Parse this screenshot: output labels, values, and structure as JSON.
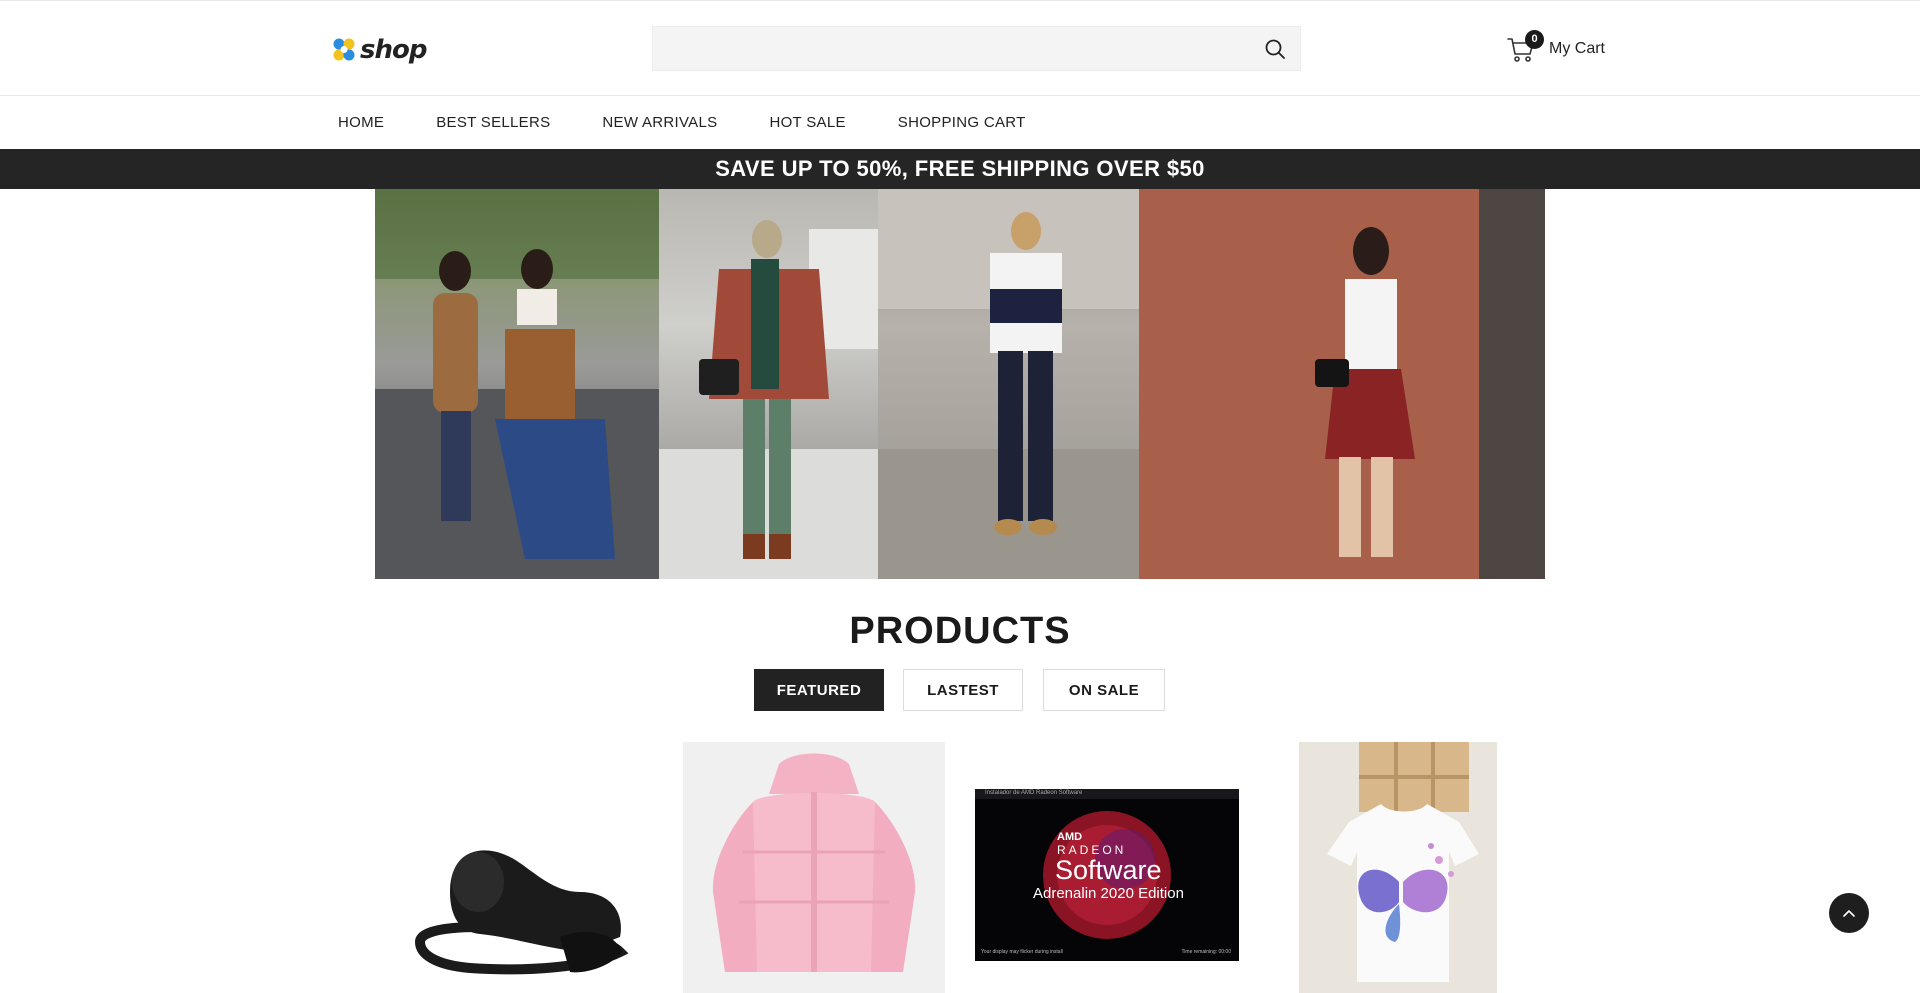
{
  "header": {
    "logo_text": "shop",
    "search": {
      "value": "",
      "placeholder": ""
    },
    "cart": {
      "count": "0",
      "label": "My Cart"
    }
  },
  "nav": {
    "items": [
      {
        "label": "HOME"
      },
      {
        "label": "BEST SELLERS"
      },
      {
        "label": "NEW ARRIVALS"
      },
      {
        "label": "HOT SALE"
      },
      {
        "label": "SHOPPING CART"
      }
    ]
  },
  "promo": {
    "text": "SAVE UP TO 50%, FREE SHIPPING OVER $50"
  },
  "products": {
    "title": "PRODUCTS",
    "tabs": [
      {
        "label": "FEATURED",
        "active": true
      },
      {
        "label": "LASTEST",
        "active": false
      },
      {
        "label": "ON SALE",
        "active": false
      }
    ],
    "cards": [
      {
        "image": "black-shoe-cover"
      },
      {
        "image": "pink-puffer-jacket"
      },
      {
        "image": "amd-radeon-software-screenshot",
        "window_title": "Instalador de AMD Radeon Software",
        "brand": "AMD",
        "line1": "RADEON",
        "line2": "Software",
        "line3": "Adrenalin 2020 Edition",
        "footer": "Your display may flicker during install",
        "timer": "Time remaining: 00:00"
      },
      {
        "image": "butterfly-print-tshirt"
      }
    ]
  },
  "colors": {
    "promo_bg": "#252525",
    "active_tab_bg": "#222222",
    "logo_blue": "#2a8de0",
    "logo_yellow": "#f3c21c"
  },
  "icons": {
    "search": "search-icon",
    "cart": "cart-icon",
    "scroll_top": "chevron-up-icon"
  }
}
